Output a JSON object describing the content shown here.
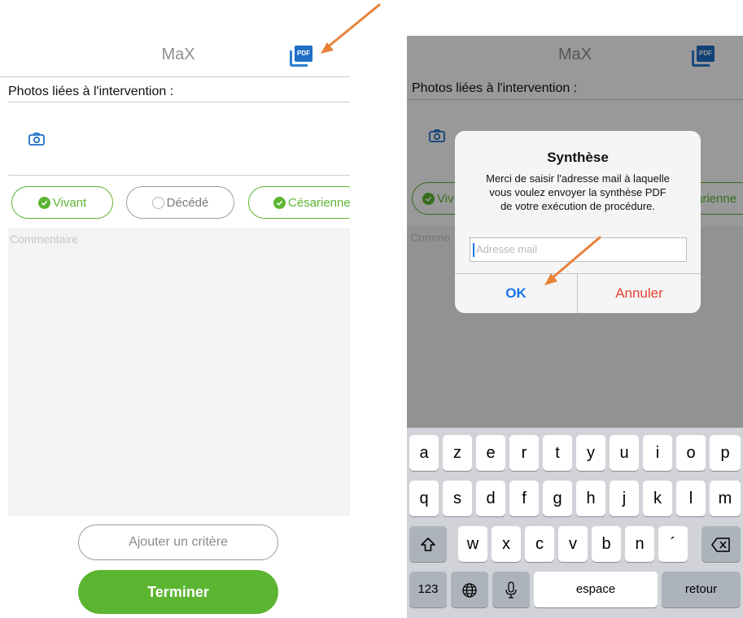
{
  "left_screen": {
    "title": "MaX",
    "pdf_icon_text": "PDF",
    "photos_label": "Photos liées à l'intervention :",
    "chips": [
      {
        "label": "Vivant",
        "checked": true
      },
      {
        "label": "Décédé",
        "checked": false
      },
      {
        "label": "Césarienne",
        "checked": true
      }
    ],
    "comment_placeholder": "Commentaire",
    "add_criterion_label": "Ajouter un critère",
    "finish_label": "Terminer"
  },
  "right_screen": {
    "title": "MaX",
    "pdf_icon_text": "PDF",
    "photos_label": "Photos liées à l'intervention :",
    "chip_left_partial": "Viv",
    "chip_right_partial": "arienne",
    "comment_partial": "Comme",
    "dialog": {
      "title": "Synthèse",
      "message_line1": "Merci de saisir l'adresse mail à laquelle",
      "message_line2": "vous voulez envoyer la synthèse PDF",
      "message_line3": "de votre exécution de procédure.",
      "input_placeholder": "Adresse mail",
      "ok_label": "OK",
      "cancel_label": "Annuler"
    },
    "keyboard": {
      "row1": [
        "a",
        "z",
        "e",
        "r",
        "t",
        "y",
        "u",
        "i",
        "o",
        "p"
      ],
      "row2": [
        "q",
        "s",
        "d",
        "f",
        "g",
        "h",
        "j",
        "k",
        "l",
        "m"
      ],
      "row3": [
        "w",
        "x",
        "c",
        "v",
        "b",
        "n",
        "´"
      ],
      "numbers_label": "123",
      "space_label": "espace",
      "return_label": "retour"
    }
  },
  "colors": {
    "accent_green": "#5cb531",
    "ios_blue": "#1a73e8",
    "destructive_red": "#ea4335",
    "annotation_arrow": "#e8823a"
  },
  "icons": [
    "pdf-icon",
    "camera-icon",
    "checkmark-icon",
    "shift-icon",
    "backspace-icon",
    "globe-icon",
    "microphone-icon",
    "arrow-annotation"
  ]
}
